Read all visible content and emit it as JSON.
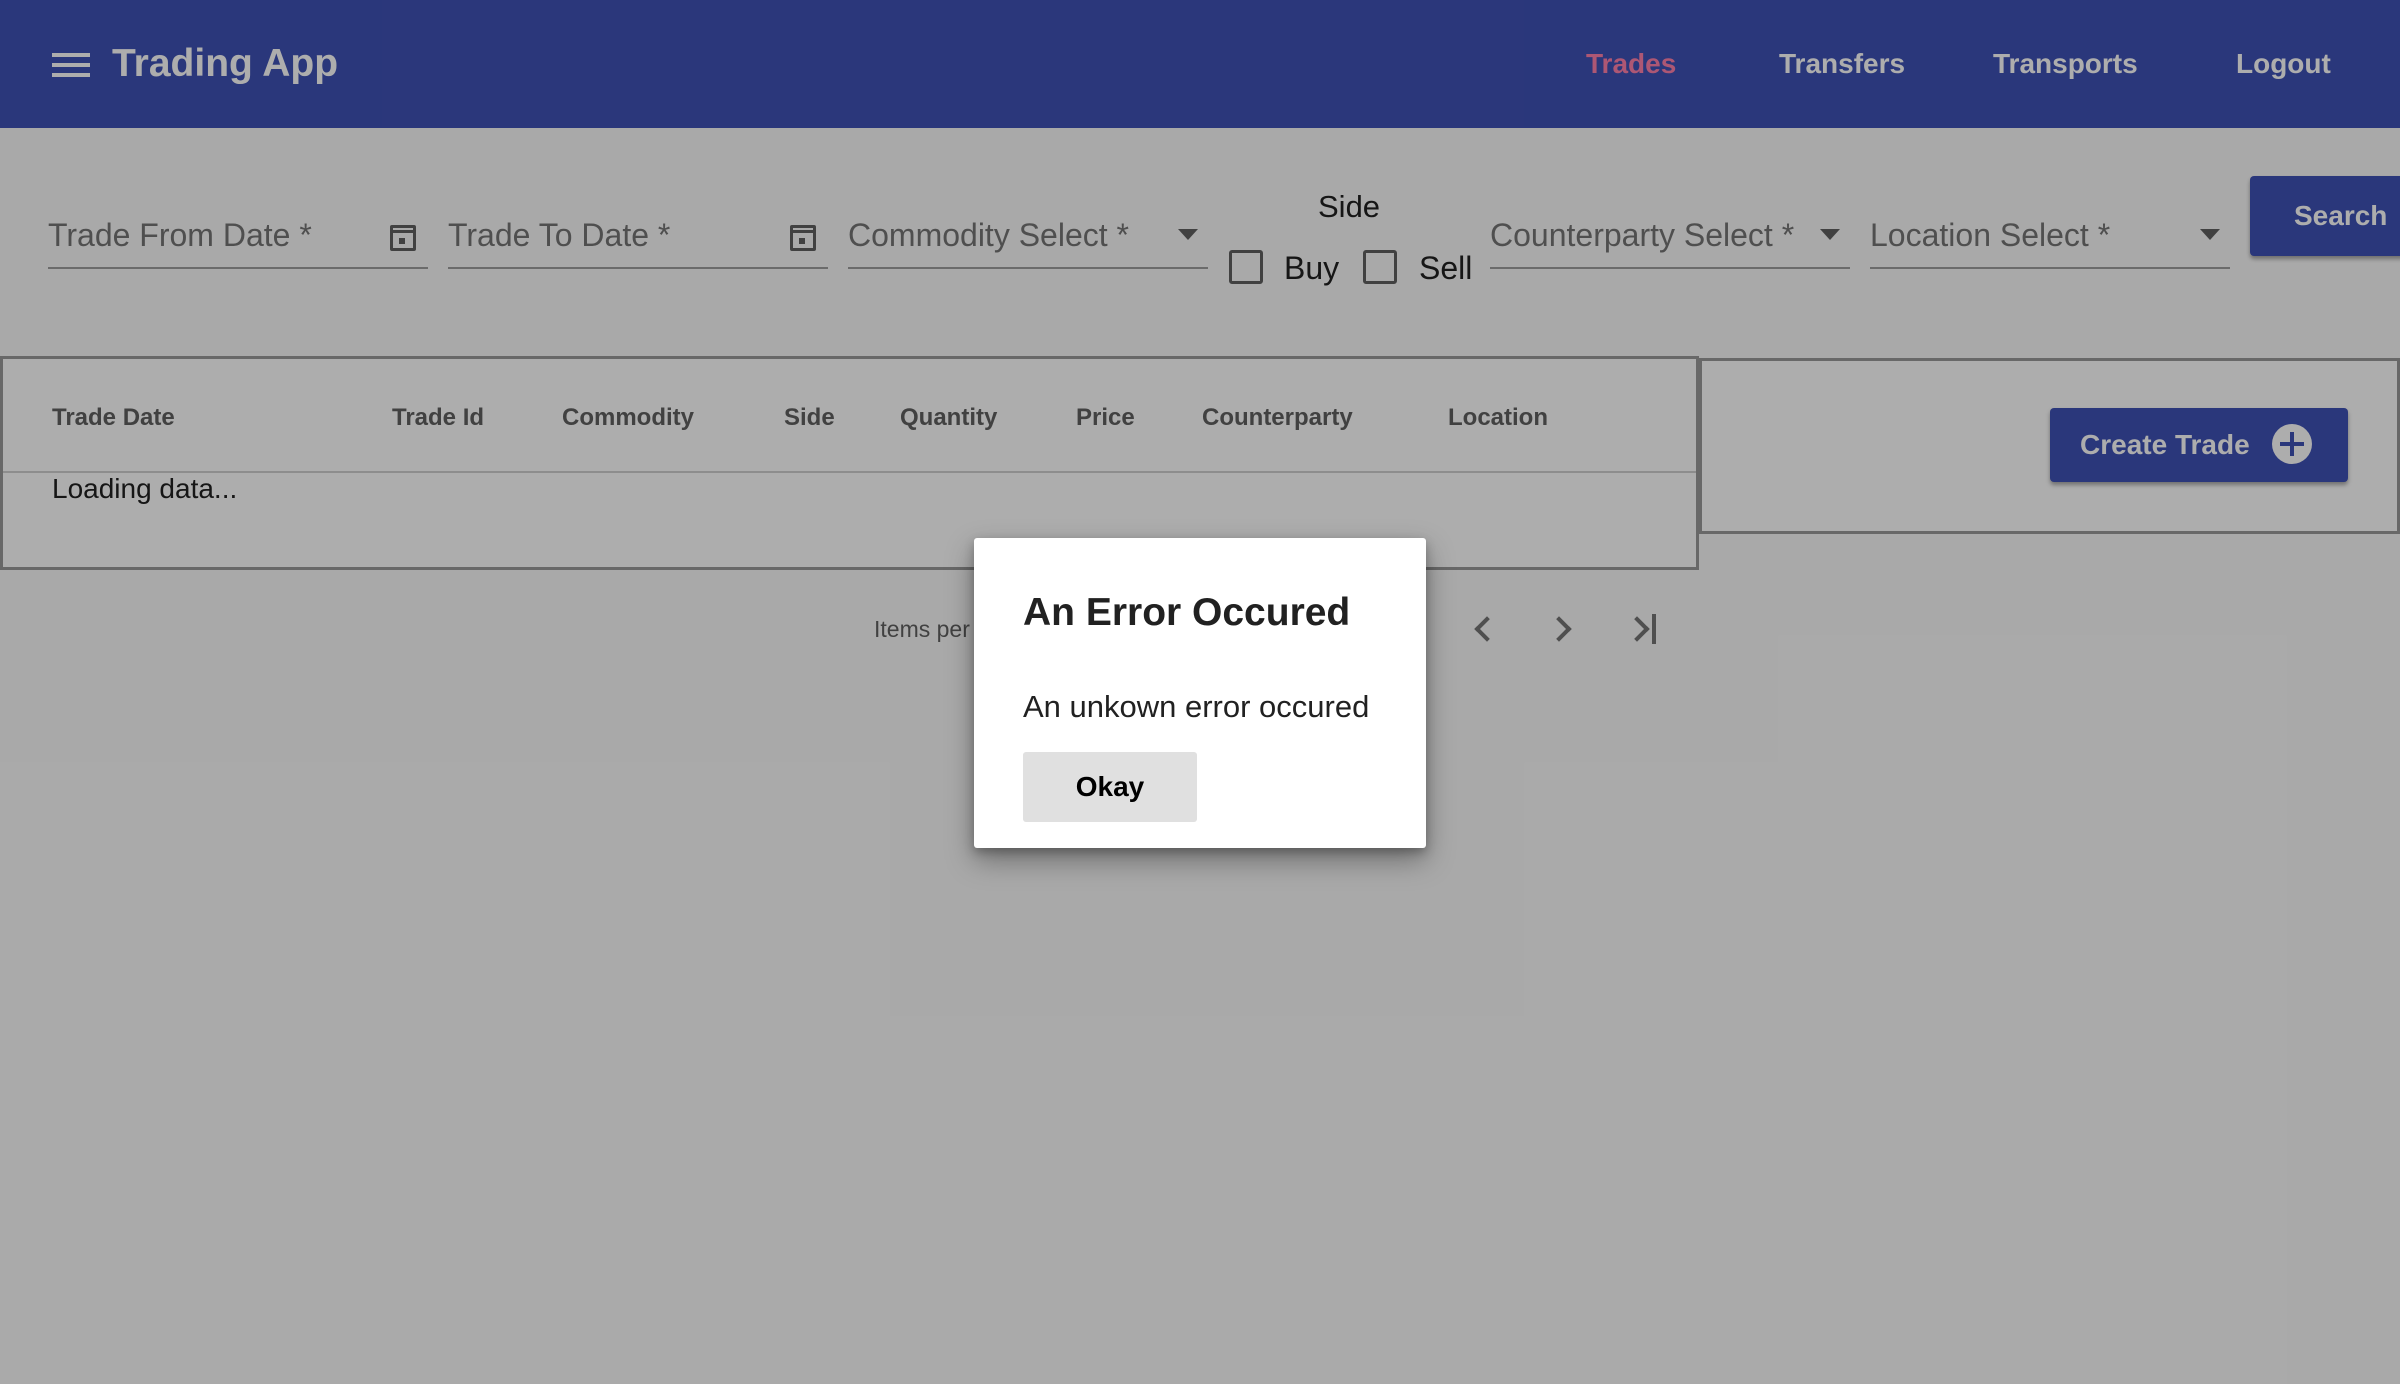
{
  "app": {
    "title": "Trading App"
  },
  "nav": {
    "items": [
      {
        "label": "Trades",
        "active": true
      },
      {
        "label": "Transfers",
        "active": false
      },
      {
        "label": "Transports",
        "active": false
      },
      {
        "label": "Logout",
        "active": false
      }
    ]
  },
  "filters": {
    "trade_from_date": {
      "placeholder": "Trade From Date *",
      "icon": "calendar-icon"
    },
    "trade_to_date": {
      "placeholder": "Trade To Date *",
      "icon": "calendar-icon"
    },
    "commodity": {
      "placeholder": "Commodity Select *"
    },
    "side": {
      "label": "Side",
      "options": [
        {
          "label": "Buy",
          "checked": false
        },
        {
          "label": "Sell",
          "checked": false
        }
      ]
    },
    "counterparty": {
      "placeholder": "Counterparty Select *"
    },
    "location": {
      "placeholder": "Location Select *"
    },
    "search_label": "Search"
  },
  "table": {
    "columns": [
      "Trade Date",
      "Trade Id",
      "Commodity",
      "Side",
      "Quantity",
      "Price",
      "Counterparty",
      "Location"
    ],
    "status": "Loading data..."
  },
  "paginator": {
    "items_per_page_label": "Items per"
  },
  "actions": {
    "create_trade_label": "Create Trade"
  },
  "dialog": {
    "title": "An Error Occured",
    "message": "An unkown error occured",
    "button_label": "Okay"
  },
  "colors": {
    "primary": "#3f51b5",
    "accent": "#ff80ab",
    "backdrop": "rgba(0,0,0,0.32)"
  }
}
